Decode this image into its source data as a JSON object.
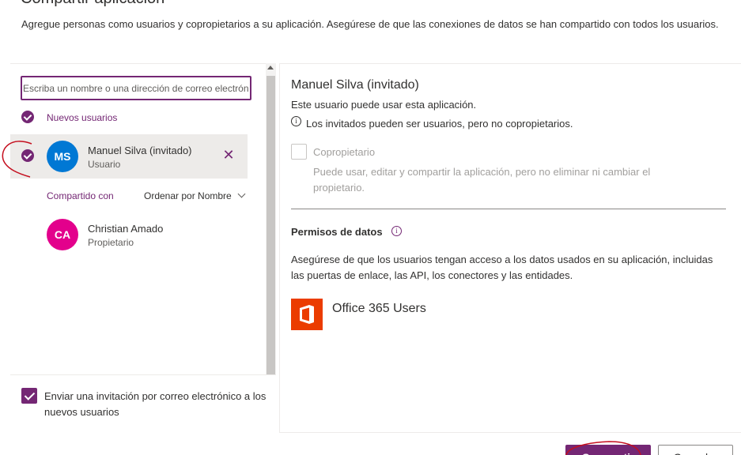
{
  "dialog": {
    "title_partial": "Compartir aplicación",
    "description": "Agregue personas como usuarios y copropietarios a su aplicación. Asegúrese de que las conexiones de datos se han compartido con todos los usuarios."
  },
  "search": {
    "placeholder": "Escriba un nombre o una dirección de correo electrón"
  },
  "new_users": {
    "label": "Nuevos usuarios",
    "items": [
      {
        "initials": "MS",
        "name": "Manuel Silva (invitado)",
        "role": "Usuario",
        "avatar_color": "#0078d4"
      }
    ]
  },
  "shared_with": {
    "label": "Compartido con",
    "sort_label": "Ordenar por Nombre",
    "items": [
      {
        "initials": "CA",
        "name": "Christian Amado",
        "role": "Propietario",
        "avatar_color": "#e3008c"
      }
    ]
  },
  "invite": {
    "label": "Enviar una invitación por correo electrónico a los nuevos usuarios",
    "checked": true
  },
  "detail": {
    "name": "Manuel Silva (invitado)",
    "can_use": "Este usuario puede usar esta aplicación.",
    "info_glyph": "i",
    "guest_note": "Los invitados pueden ser usuarios, pero no copropietarios.",
    "coowner_label": "Copropietario",
    "coowner_checked": false,
    "coowner_desc": "Puede usar, editar y compartir la aplicación, pero no eliminar ni cambiar el propietario.",
    "permissions_title": "Permisos de datos",
    "permissions_desc": "Asegúrese de que los usuarios tengan acceso a los datos usados en su aplicación, incluidas las puertas de enlace, las API, los conectores y las entidades.",
    "connectors": [
      {
        "name": "Office 365 Users",
        "icon": "office-365-icon",
        "color": "#eb3c00"
      }
    ]
  },
  "footer": {
    "share_label": "Compartir",
    "cancel_label": "Cancelar"
  },
  "colors": {
    "accent": "#742774",
    "annotation": "#c50f1f"
  }
}
